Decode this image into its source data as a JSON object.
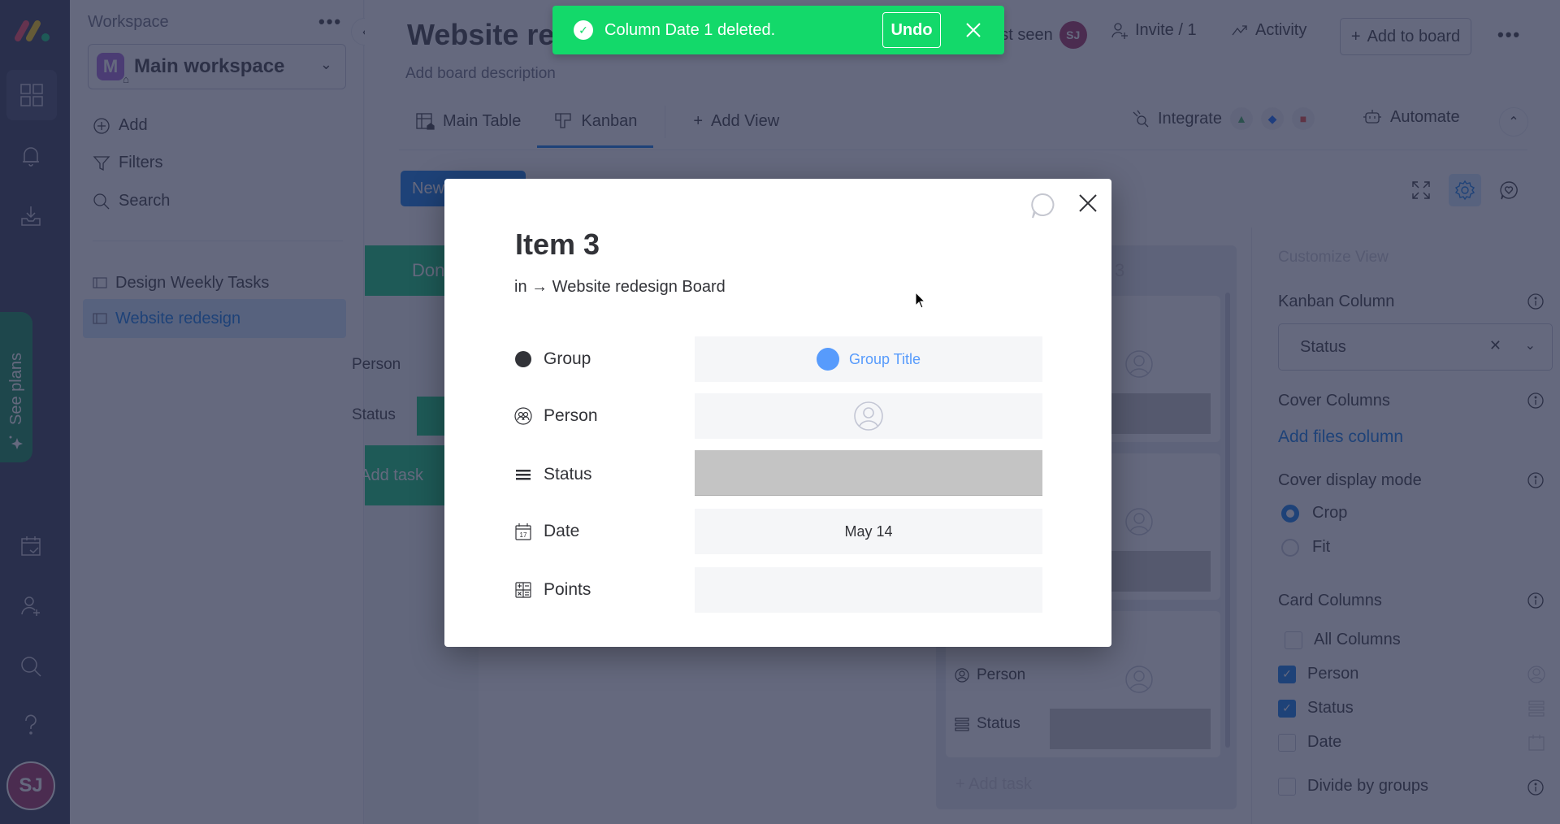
{
  "app": {
    "name": "monday.com"
  },
  "leftnav": {
    "items": [
      {
        "name": "workspaces",
        "icon": "grid-icon",
        "active": true
      },
      {
        "name": "notifications",
        "icon": "bell-icon"
      },
      {
        "name": "inbox",
        "icon": "inbox-download-icon"
      },
      {
        "name": "my-work",
        "icon": "calendar-check-icon"
      },
      {
        "name": "invite",
        "icon": "add-user-icon"
      },
      {
        "name": "search",
        "icon": "search-icon"
      },
      {
        "name": "help",
        "icon": "question-icon"
      }
    ],
    "see_plans": "See plans",
    "avatar_initials": "SJ"
  },
  "sidebar": {
    "label": "Workspace",
    "workspace_badge": "M",
    "workspace_name": "Main workspace",
    "actions": [
      {
        "label": "Add",
        "icon": "plus-circle-icon"
      },
      {
        "label": "Filters",
        "icon": "filter-icon"
      },
      {
        "label": "Search",
        "icon": "search-icon"
      }
    ],
    "boards": [
      {
        "label": "Design Weekly Tasks",
        "active": false
      },
      {
        "label": "Website redesign",
        "active": true
      }
    ]
  },
  "header": {
    "title": "Website redesign",
    "description": "Add board description",
    "last_seen_label": "Last seen",
    "last_seen_avatar": "SJ",
    "invite_label": "Invite / 1",
    "activity_label": "Activity",
    "add_to_board_label": "Add to board"
  },
  "tabs": [
    {
      "label": "Main Table",
      "icon": "table-home-icon",
      "active": false
    },
    {
      "label": "Kanban",
      "icon": "kanban-icon",
      "active": true
    },
    {
      "label": "Add View",
      "icon": "plus-icon",
      "active": false
    }
  ],
  "tools": {
    "integrate_label": "Integrate",
    "automate_label": "Automate"
  },
  "board_toolbar": {
    "new_item_label": "New Item"
  },
  "kanban": {
    "columns": [
      {
        "title": "Done",
        "color": "#00c875",
        "labels": {
          "person": "Person",
          "status": "Status"
        },
        "add_task": "+ Add task"
      },
      {
        "title": "3",
        "color": "#c4c4c4",
        "cards": [
          {
            "person_label": "Person",
            "status_label": "Status"
          },
          {
            "person_label": "Person",
            "status_label": "Status"
          },
          {
            "person_label": "Person",
            "status_label": "Status"
          }
        ],
        "add_task": "+ Add task"
      }
    ]
  },
  "customize": {
    "title": "Customize View",
    "kanban_column_label": "Kanban Column",
    "kanban_column_value": "Status",
    "cover_columns_label": "Cover Columns",
    "add_files_column": "Add files column",
    "cover_display_mode_label": "Cover display mode",
    "display_modes": [
      {
        "label": "Crop",
        "selected": true
      },
      {
        "label": "Fit",
        "selected": false
      }
    ],
    "card_columns_label": "Card Columns",
    "all_columns_label": "All Columns",
    "card_columns": [
      {
        "label": "Person",
        "checked": true,
        "icon": "person-icon"
      },
      {
        "label": "Status",
        "checked": true,
        "icon": "status-icon"
      },
      {
        "label": "Date",
        "checked": false,
        "icon": "calendar-icon"
      }
    ],
    "divide_by_groups_label": "Divide by groups"
  },
  "toast": {
    "message": "Column Date 1 deleted.",
    "undo_label": "Undo",
    "color": "#13d96a"
  },
  "modal": {
    "title": "Item 3",
    "subtitle": "in → Website redesign Board",
    "fields": [
      {
        "label": "Group",
        "icon": "group-dot-icon",
        "value": "Group Title",
        "value_color": "#579bfc"
      },
      {
        "label": "Person",
        "icon": "people-icon",
        "value": ""
      },
      {
        "label": "Status",
        "icon": "status-lines-icon",
        "value": "",
        "value_color": "#c4c4c4"
      },
      {
        "label": "Date",
        "icon": "calendar-17-icon",
        "value": "May 14"
      },
      {
        "label": "Points",
        "icon": "calculator-icon",
        "value": ""
      }
    ]
  }
}
